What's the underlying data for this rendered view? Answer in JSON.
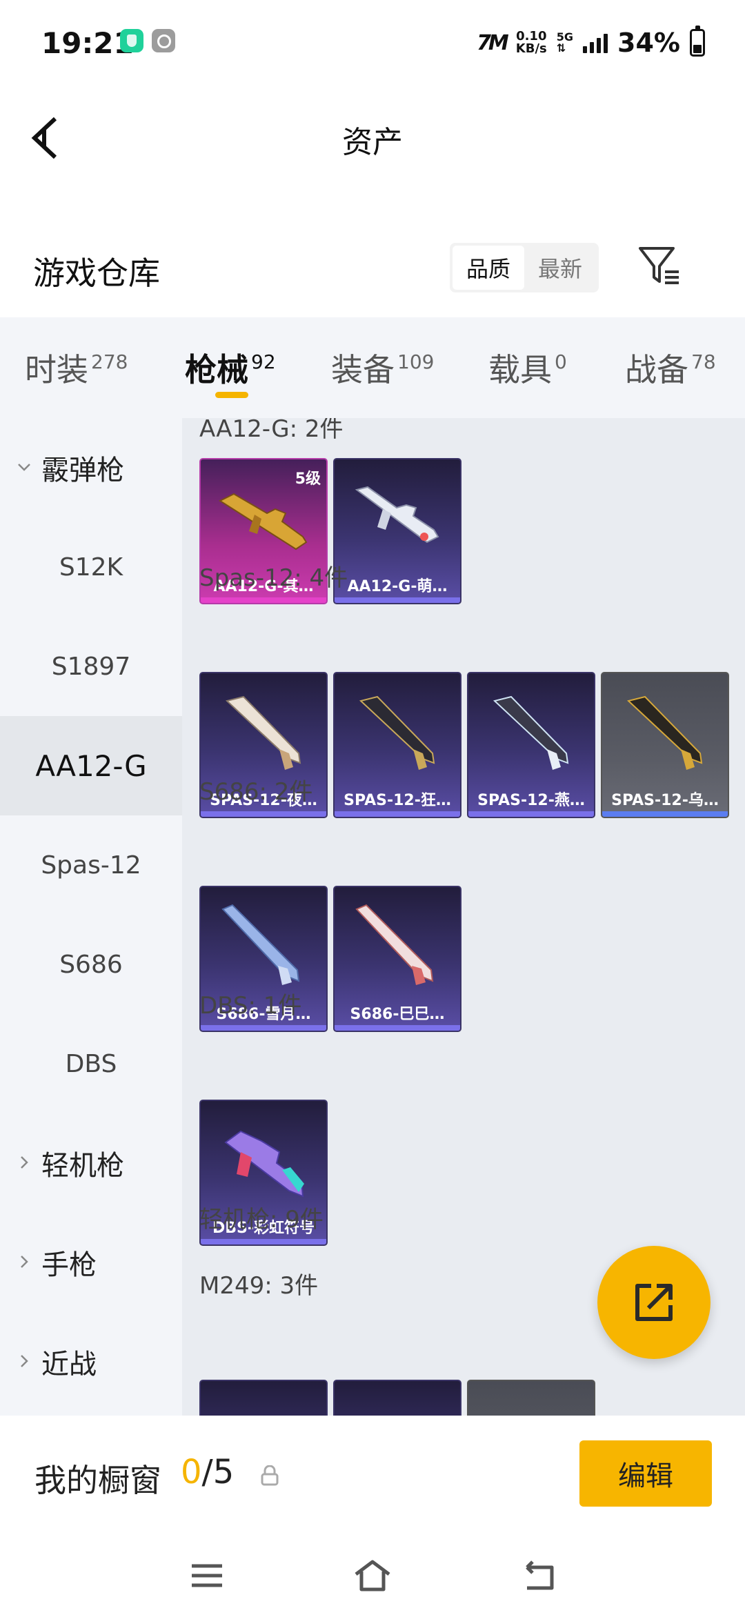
{
  "status_bar": {
    "time": "19:21",
    "brand": "7M",
    "speed_value": "0.10",
    "speed_unit": "KB/s",
    "network": "5G",
    "battery": "34%"
  },
  "header": {
    "title": "资产"
  },
  "warehouse": {
    "title": "游戏仓库",
    "sort_options": [
      "品质",
      "最新"
    ],
    "active_sort": "品质"
  },
  "categories": [
    {
      "label": "时装",
      "count": "278"
    },
    {
      "label": "枪械",
      "count": "92"
    },
    {
      "label": "装备",
      "count": "109"
    },
    {
      "label": "载具",
      "count": "0"
    },
    {
      "label": "战备",
      "count": "78"
    }
  ],
  "sidebar": {
    "items": [
      {
        "label": "霰弹枪",
        "type": "group",
        "expanded": true
      },
      {
        "label": "S12K",
        "type": "sub"
      },
      {
        "label": "S1897",
        "type": "sub"
      },
      {
        "label": "AA12-G",
        "type": "sub",
        "active": true
      },
      {
        "label": "Spas-12",
        "type": "sub"
      },
      {
        "label": "S686",
        "type": "sub"
      },
      {
        "label": "DBS",
        "type": "sub"
      },
      {
        "label": "轻机枪",
        "type": "group",
        "expanded": false
      },
      {
        "label": "手枪",
        "type": "group",
        "expanded": false
      },
      {
        "label": "近战",
        "type": "group",
        "expanded": false
      }
    ]
  },
  "sections": [
    {
      "heading": "AA12-G: 2件",
      "cards": [
        {
          "name": "AA12-G-其…",
          "level": "5级",
          "rarity": "magenta"
        },
        {
          "name": "AA12-G-萌…",
          "rarity": "purple"
        }
      ]
    },
    {
      "heading": "Spas-12: 4件",
      "cards": [
        {
          "name": "SPAS-12-夜…",
          "rarity": "purple"
        },
        {
          "name": "SPAS-12-狂…",
          "rarity": "purple"
        },
        {
          "name": "SPAS-12-燕…",
          "rarity": "purple"
        },
        {
          "name": "SPAS-12-乌…",
          "rarity": "grey"
        }
      ]
    },
    {
      "heading": "S686: 2件",
      "cards": [
        {
          "name": "S686-雪月…",
          "rarity": "purple"
        },
        {
          "name": "S686-巳巳…",
          "rarity": "purple"
        }
      ]
    },
    {
      "heading": "DBS: 1件",
      "cards": [
        {
          "name": "DBS-彩虹符号",
          "rarity": "purple"
        }
      ]
    },
    {
      "heading": "轻机枪: 9件",
      "cards": []
    },
    {
      "heading": "M249: 3件",
      "cards": [
        {
          "name": "",
          "rarity": "purple"
        },
        {
          "name": "",
          "rarity": "purple"
        },
        {
          "name": "",
          "rarity": "grey"
        }
      ]
    }
  ],
  "showcase": {
    "label": "我的橱窗",
    "current": "0",
    "separator": "/",
    "total": "5",
    "edit_label": "编辑"
  },
  "colors": {
    "accent": "#f7b500",
    "rarity_magenta": "#cc3cb0",
    "rarity_purple": "#5a4ea6",
    "rarity_grey": "#6a6c76"
  },
  "icons": [
    "back-arrow-icon",
    "filter-icon",
    "chevron-down-icon",
    "chevron-right-icon",
    "share-icon",
    "lock-icon",
    "menu-icon",
    "home-icon",
    "return-icon"
  ]
}
